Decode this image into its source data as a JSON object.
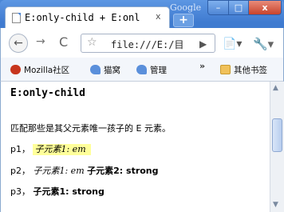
{
  "browser": {
    "brand": "Google",
    "tab_title": "E:only-child + E:onl",
    "tab_close": "x",
    "new_tab": "+",
    "window_buttons": {
      "minimize": "–",
      "maximize": "□",
      "close": "x"
    }
  },
  "toolbar": {
    "url": "file:///E:/",
    "url_suffix": "目",
    "back": "←",
    "forward": "→",
    "reload": "C",
    "star": "☆",
    "go": "▶",
    "page_menu": "📄▾",
    "tools_menu": "🔧▾"
  },
  "bookmarks": {
    "items": [
      "Mozilla社区",
      "猫窝",
      "管理"
    ],
    "more": "»",
    "other": "其他书签"
  },
  "page": {
    "heading": "E:only-child",
    "description": "匹配那些是其父元素唯一孩子的 E 元素。",
    "p1_label": "p1，",
    "p1_em": "子元素1: em",
    "p2_label": "p2，",
    "p2_em": "子元素1: em",
    "p2_strong": "子元素2: strong",
    "p3_label": "p3，",
    "p3_strong": "子元素1: strong"
  },
  "colors": {
    "highlight": "#ffff9a",
    "window_blue": "#3f7bd0"
  }
}
